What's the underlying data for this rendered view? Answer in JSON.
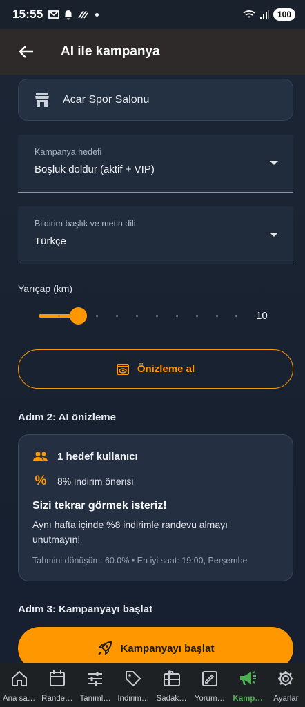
{
  "status": {
    "time": "15:55",
    "battery": "100"
  },
  "appbar": {
    "title": "AI ile kampanya"
  },
  "business": {
    "name": "Acar Spor Salonu"
  },
  "goal_field": {
    "label": "Kampanya hedefi",
    "value": "Boşluk doldur (aktif + VIP)"
  },
  "language_field": {
    "label": "Bildirim başlık ve metin dili",
    "value": "Türkçe"
  },
  "radius": {
    "label": "Yarıçap (km)",
    "value": "10",
    "fraction": 0.1
  },
  "preview_button": {
    "label": "Önizleme al"
  },
  "step2": {
    "title": "Adım 2: AI önizleme"
  },
  "preview_card": {
    "target_users": "1 hedef kullanıcı",
    "discount_symbol": "%",
    "discount": "8% indirim önerisi",
    "headline": "Sizi tekrar görmek isteriz!",
    "body": "Aynı hafta içinde %8 indirimle randevu almayı unutmayın!",
    "meta": "Tahmini dönüşüm: 60.0% • En iyi saat: 19:00, Perşembe"
  },
  "step3": {
    "title": "Adım 3: Kampanyayı başlat"
  },
  "launch_button": {
    "label": "Kampanyayı başlat"
  },
  "colors": {
    "accent": "#ff9800",
    "active_nav": "#4caf50"
  },
  "bottom_nav": [
    {
      "label": "Ana sa…",
      "icon": "home-icon"
    },
    {
      "label": "Rande…",
      "icon": "calendar-icon"
    },
    {
      "label": "Tanıml…",
      "icon": "sliders-icon"
    },
    {
      "label": "İndirim…",
      "icon": "tag-icon"
    },
    {
      "label": "Sadak…",
      "icon": "gift-card-icon"
    },
    {
      "label": "Yorum…",
      "icon": "review-icon"
    },
    {
      "label": "Kamp…",
      "icon": "megaphone-icon",
      "active": true
    },
    {
      "label": "Ayarlar",
      "icon": "gear-icon"
    }
  ]
}
